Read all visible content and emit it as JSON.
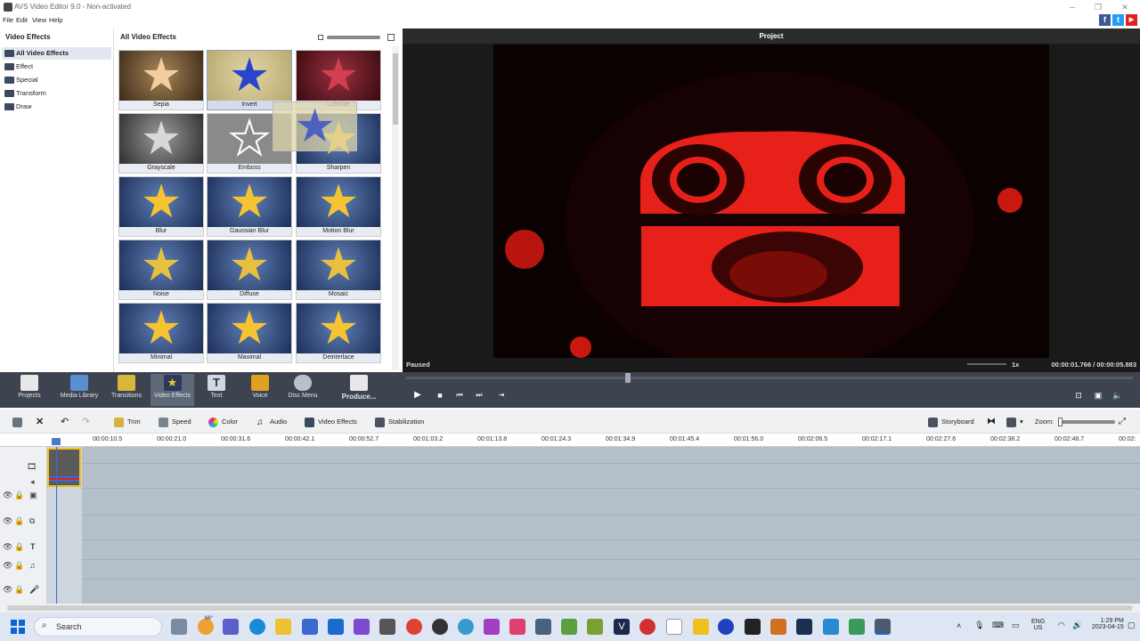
{
  "window": {
    "title": "AVS Video Editor 9.0 - Non-activated"
  },
  "menu": [
    "File",
    "Edit",
    "View",
    "Help"
  ],
  "social": [
    "f",
    "t",
    "▶"
  ],
  "tree": {
    "header": "Video Effects",
    "items": [
      "All Video Effects",
      "Effect",
      "Special",
      "Transform",
      "Draw"
    ]
  },
  "gallery": {
    "header": "All Video Effects",
    "effects": [
      "Sepia",
      "Invert",
      "Colorize",
      "Grayscale",
      "Emboss",
      "Sharpen",
      "Blur",
      "Gaussian Blur",
      "Motion Blur",
      "Noise",
      "Diffuse",
      "Mosaic",
      "Minimal",
      "Maximal",
      "Deinterlace"
    ],
    "selected": "Invert"
  },
  "preview": {
    "title": "Project",
    "status": "Paused",
    "speed": "1x",
    "time": "00:00:01.766 / 00:00:05.883"
  },
  "toolbar": {
    "items": [
      "Projects",
      "Media Library",
      "Transitions",
      "Video Effects",
      "Text",
      "Voice",
      "Disc Menu",
      "Produce..."
    ],
    "active": "Video Effects"
  },
  "timeline_tools": {
    "trim": "Trim",
    "speed": "Speed",
    "color": "Color",
    "audio": "Audio",
    "video_effects": "Video Effects",
    "stabilization": "Stabilization",
    "storyboard": "Storyboard",
    "zoom": "Zoom:"
  },
  "ruler": [
    "00:00:10.5",
    "00:00:21.0",
    "00:00:31.6",
    "00:00:42.1",
    "00:00:52.7",
    "00:01:03.2",
    "00:01:13.8",
    "00:01:24.3",
    "00:01:34.9",
    "00:01:45.4",
    "00:01:56.0",
    "00:02:06.5",
    "00:02:17.1",
    "00:02:27.6",
    "00:02:38.2",
    "00:02:48.7",
    "00:02:"
  ],
  "taskbar": {
    "search": "Search",
    "badge": "66°",
    "lang": "ENG",
    "region": "US",
    "time": "1:29 PM",
    "date": "2023-04-15"
  },
  "colors": {
    "dark_toolbar": "#3d4450",
    "accent": "#f6c431",
    "video_red": "#e8201a"
  }
}
